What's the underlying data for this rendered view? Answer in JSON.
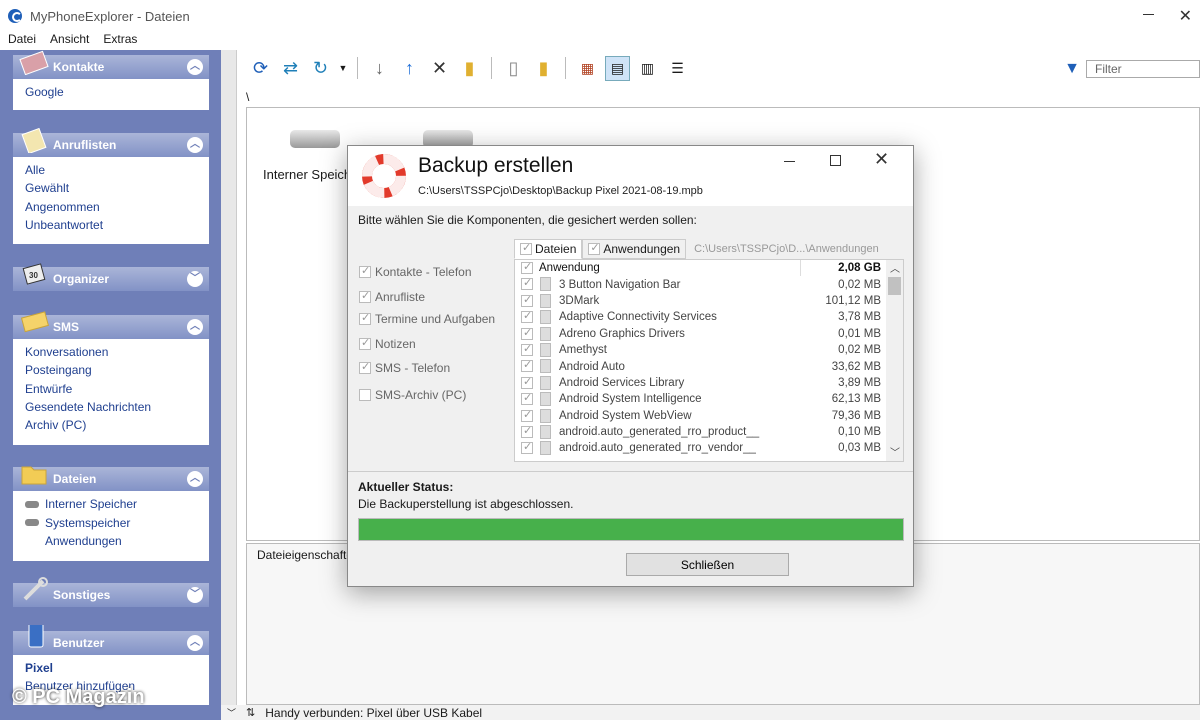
{
  "window": {
    "title": "MyPhoneExplorer - Dateien"
  },
  "menu": [
    "Datei",
    "Ansicht",
    "Extras"
  ],
  "sidebar": {
    "kontakte": {
      "title": "Kontakte",
      "items": [
        "Google"
      ]
    },
    "anruflisten": {
      "title": "Anruflisten",
      "items": [
        "Alle",
        "Gewählt",
        "Angenommen",
        "Unbeantwortet"
      ]
    },
    "organizer": {
      "title": "Organizer"
    },
    "sms": {
      "title": "SMS",
      "items": [
        "Konversationen",
        "Posteingang",
        "Entwürfe",
        "Gesendete Nachrichten",
        "Archiv (PC)"
      ]
    },
    "dateien": {
      "title": "Dateien",
      "items": [
        "Interner Speicher",
        "Systemspeicher",
        "Anwendungen"
      ]
    },
    "sonstiges": {
      "title": "Sonstiges"
    },
    "benutzer": {
      "title": "Benutzer",
      "items": [
        "Pixel",
        "Benutzer hinzufügen"
      ]
    }
  },
  "toolbar": {
    "filter_placeholder": "Filter",
    "icons": [
      "refresh-icon",
      "sync-icon",
      "reload-icon",
      "download-icon",
      "upload-icon",
      "delete-icon",
      "new-folder-icon",
      "properties-icon",
      "folder-icon",
      "thumbnail-view-icon",
      "large-icon-view-icon",
      "list-view-icon",
      "details-view-icon"
    ]
  },
  "files": {
    "path": "\\",
    "drives": [
      "Interner Speicher",
      ""
    ],
    "properties_title": "Dateieigenschaften"
  },
  "statusbar": {
    "text": "Handy verbunden: Pixel über USB Kabel"
  },
  "watermark": "© PC Magazin",
  "dialog": {
    "title": "Backup erstellen",
    "path": "C:\\Users\\TSSPCjo\\Desktop\\Backup Pixel 2021-08-19.mpb",
    "instruction": "Bitte wählen Sie die Komponenten, die gesichert werden sollen:",
    "components": [
      {
        "label": "Kontakte - Telefon",
        "checked": true
      },
      {
        "label": "Anrufliste",
        "checked": true
      },
      {
        "label": "Termine und Aufgaben",
        "checked": true
      },
      {
        "label": "Notizen",
        "checked": true
      },
      {
        "label": "SMS - Telefon",
        "checked": true
      },
      {
        "label": "SMS-Archiv (PC)",
        "checked": false
      }
    ],
    "tabs": [
      "Dateien",
      "Anwendungen"
    ],
    "tab_path": "C:\\Users\\TSSPCjo\\D...\\Anwendungen",
    "list_header": {
      "name": "Anwendung",
      "size": "2,08 GB"
    },
    "apps": [
      {
        "name": "3 Button Navigation Bar",
        "size": "0,02 MB"
      },
      {
        "name": "3DMark",
        "size": "101,12 MB"
      },
      {
        "name": "Adaptive Connectivity Services",
        "size": "3,78 MB"
      },
      {
        "name": "Adreno Graphics Drivers",
        "size": "0,01 MB"
      },
      {
        "name": "Amethyst",
        "size": "0,02 MB"
      },
      {
        "name": "Android Auto",
        "size": "33,62 MB"
      },
      {
        "name": "Android Services Library",
        "size": "3,89 MB"
      },
      {
        "name": "Android System Intelligence",
        "size": "62,13 MB"
      },
      {
        "name": "Android System WebView",
        "size": "79,36 MB"
      },
      {
        "name": "android.auto_generated_rro_product__",
        "size": "0,10 MB"
      },
      {
        "name": "android.auto_generated_rro_vendor__",
        "size": "0,03 MB"
      }
    ],
    "status_label": "Aktueller Status:",
    "status_message": "Die Backuperstellung ist abgeschlossen.",
    "progress": 1.0,
    "close_button": "Schließen"
  },
  "colors": {
    "sidebar": "#6f7fb8",
    "progress": "#47b04b",
    "link": "#1f3f8f"
  }
}
